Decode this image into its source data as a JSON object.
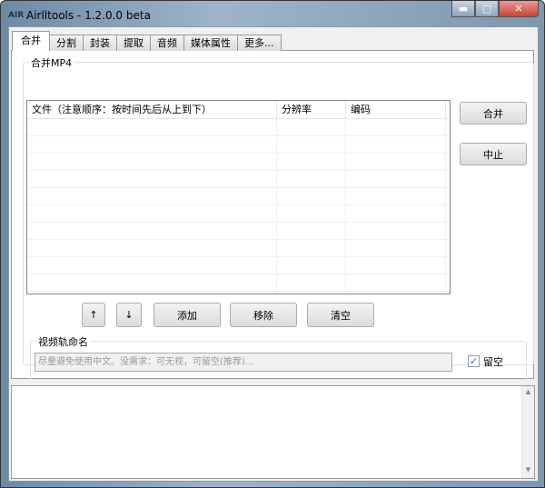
{
  "window": {
    "title": "Airlltools  -  1.2.0.0 beta",
    "icon_label": "AIR"
  },
  "tabs": [
    "合并",
    "分割",
    "封装",
    "提取",
    "音频",
    "媒体属性",
    "更多..."
  ],
  "merge": {
    "group_title": "合并MP4",
    "columns": [
      "文件（注意顺序：按时间先后从上到下）",
      "分辨率",
      "编码"
    ],
    "rows": [],
    "merge_button": "合并",
    "stop_button": "中止",
    "up_button": "↑",
    "down_button": "↓",
    "add_button": "添加",
    "remove_button": "移除",
    "clear_button": "清空",
    "track_group_title": "视频轨命名",
    "track_placeholder": "尽量避免使用中文。没需求：可无视，可留空(推荐)...",
    "leave_empty_label": "留空",
    "leave_empty_checked": true
  },
  "log": {
    "text": ""
  }
}
